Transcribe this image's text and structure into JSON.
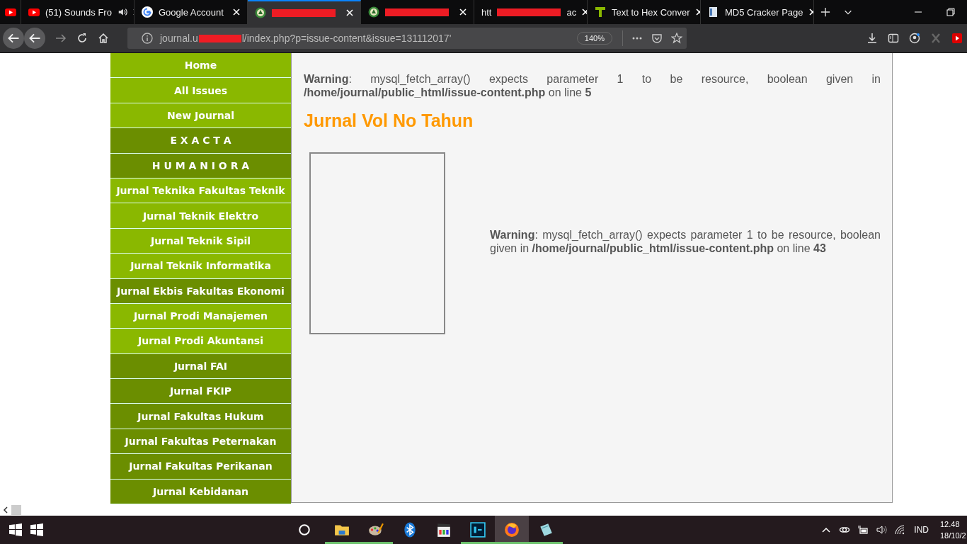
{
  "tabs": [
    {
      "kind": "youtube",
      "selected": false,
      "pinned": true
    },
    {
      "kind": "youtube",
      "label": "(51) Sounds Fro",
      "selected": false,
      "audio": true
    },
    {
      "kind": "google",
      "label": "Google Account",
      "selected": false
    },
    {
      "kind": "journal",
      "selected": true,
      "redacted": true
    },
    {
      "kind": "journal",
      "selected": false,
      "redacted": true
    },
    {
      "kind": "none",
      "label": "htt",
      "label_end": "ac",
      "selected": false,
      "redacted": true
    },
    {
      "kind": "hex",
      "label": "Text to Hex Conver",
      "selected": false
    },
    {
      "kind": "doc",
      "label": "MD5 Cracker Page",
      "selected": false
    }
  ],
  "address_bar": {
    "url_start": "journal.u",
    "url_end": "l/index.php?p=issue-content&issue=131112017'",
    "zoom": "140%"
  },
  "sidebar": {
    "items": [
      {
        "label": "Home",
        "color": "#8ab800"
      },
      {
        "label": "All Issues",
        "color": "#8ab800"
      },
      {
        "label": "New Journal",
        "color": "#8ab800"
      },
      {
        "label": "E X A C T A",
        "color": "#6b8e00"
      },
      {
        "label": "H U M A N I O R A",
        "color": "#6b8e00"
      },
      {
        "label": "Jurnal Teknika Fakultas Teknik",
        "color": "#8ab800"
      },
      {
        "label": "Jurnal Teknik Elektro",
        "color": "#8ab800"
      },
      {
        "label": "Jurnal Teknik Sipil",
        "color": "#8ab800"
      },
      {
        "label": "Jurnal Teknik Informatika",
        "color": "#8ab800"
      },
      {
        "label": "Jurnal Ekbis Fakultas Ekonomi",
        "color": "#6b8e00"
      },
      {
        "label": "Jurnal Prodi Manajemen",
        "color": "#8ab800"
      },
      {
        "label": "Jurnal Prodi Akuntansi",
        "color": "#8ab800"
      },
      {
        "label": "Jurnal FAI",
        "color": "#6b8e00"
      },
      {
        "label": "Jurnal FKIP",
        "color": "#6b8e00"
      },
      {
        "label": "Jurnal Fakultas Hukum",
        "color": "#6b8e00"
      },
      {
        "label": "Jurnal Fakultas Peternakan",
        "color": "#6b8e00"
      },
      {
        "label": "Jurnal Fakultas Perikanan",
        "color": "#6b8e00"
      },
      {
        "label": "Jurnal Kebidanan",
        "color": "#6b8e00"
      }
    ]
  },
  "content": {
    "warning_1": "**Warning**: mysql_fetch_array() expects parameter 1 to be resource, boolean given in **/home/journal/public_html/issue-content.php** on line **5**",
    "heading": "Jurnal Vol No Tahun",
    "warning_2": "**Warning**: mysql_fetch_array() expects parameter 1 to be resource, boolean given in **/home/journal/public_html/issue-content.php** on line **43**"
  },
  "taskbar": {
    "apps": [
      {
        "kind": "explorer",
        "running": true
      },
      {
        "kind": "paint",
        "running": true
      },
      {
        "kind": "bluetooth",
        "running": false
      },
      {
        "kind": "media",
        "running": false
      },
      {
        "kind": "photoshop",
        "running": true
      },
      {
        "kind": "firefox",
        "running": true,
        "selected": true
      },
      {
        "kind": "notepad",
        "running": true
      }
    ],
    "language": "IND",
    "time": "12.48",
    "date": "18/10/2"
  }
}
